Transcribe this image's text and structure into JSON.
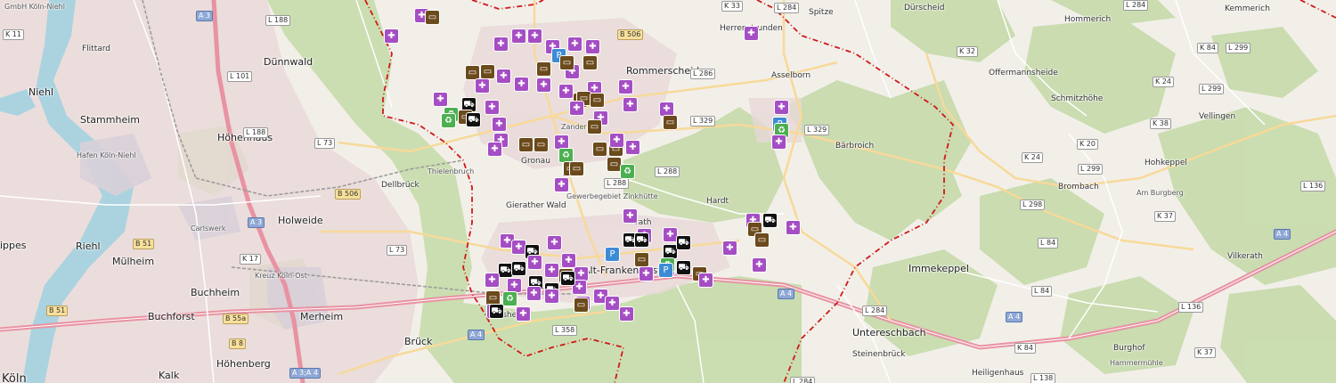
{
  "map": {
    "poi_colors": {
      "medical": "#a54ec4",
      "hotel": "#6b4a1c",
      "car": "#111111",
      "parking": "#3d8bd4",
      "recycling": "#4caf50",
      "generic": "#777777"
    },
    "poi_icons": {
      "medical": "medical-cross-icon",
      "hotel": "hotel-bed-icon",
      "car": "car-icon",
      "parking": "parking-icon",
      "recycling": "recycling-icon",
      "generic": "generic-poi-icon"
    },
    "labels": [
      {
        "id": "gmbh-koln-niehl",
        "text": "GmbH Köln-Niehl"
      },
      {
        "id": "flittard",
        "text": "Flittard"
      },
      {
        "id": "niehl",
        "text": "Niehl"
      },
      {
        "id": "stammheim",
        "text": "Stammheim"
      },
      {
        "id": "hafen-koln-niehl",
        "text": "Hafen Köln-Niehl"
      },
      {
        "id": "dunnwald",
        "text": "Dünnwald"
      },
      {
        "id": "hohenhaus",
        "text": "Höhenhaus"
      },
      {
        "id": "carlswerk",
        "text": "Carlswerk"
      },
      {
        "id": "holweide",
        "text": "Holweide"
      },
      {
        "id": "dellbruck",
        "text": "Dellbrück"
      },
      {
        "id": "riehl",
        "text": "Riehl"
      },
      {
        "id": "ippes",
        "text": "ippes"
      },
      {
        "id": "mulheim",
        "text": "Mülheim"
      },
      {
        "id": "buchheim",
        "text": "Buchheim"
      },
      {
        "id": "buchforst",
        "text": "Buchforst"
      },
      {
        "id": "merheim",
        "text": "Merheim"
      },
      {
        "id": "kalk",
        "text": "Kalk"
      },
      {
        "id": "koln",
        "text": "Köln"
      },
      {
        "id": "hohenberg",
        "text": "Höhenberg"
      },
      {
        "id": "bruck",
        "text": "Brück"
      },
      {
        "id": "gronau",
        "text": "Gronau"
      },
      {
        "id": "zanders",
        "text": "Zanders"
      },
      {
        "id": "gierather-wald",
        "text": "Gierather Wald"
      },
      {
        "id": "gewerbegebiet-zinkhutte",
        "text": "Gewerbegebiet Zinkhütte"
      },
      {
        "id": "alt-frankenforst",
        "text": "Alt-Frankenforst"
      },
      {
        "id": "rommerscheid",
        "text": "Rommerscheid"
      },
      {
        "id": "asselborn",
        "text": "Asselborn"
      },
      {
        "id": "herrenstrunden",
        "text": "Herrenstrunden"
      },
      {
        "id": "spitze",
        "text": "Spitze"
      },
      {
        "id": "durscheid",
        "text": "Dürscheid"
      },
      {
        "id": "offermannsheide",
        "text": "Offermannsheide"
      },
      {
        "id": "barbroich",
        "text": "Bärbroich"
      },
      {
        "id": "hardt",
        "text": "Hardt"
      },
      {
        "id": "immekeppel",
        "text": "Immekeppel"
      },
      {
        "id": "untereschbach",
        "text": "Untereschbach"
      },
      {
        "id": "steinenbruck",
        "text": "Steinenbrück"
      },
      {
        "id": "heiligenhaus",
        "text": "Heiligenhaus"
      },
      {
        "id": "brombach",
        "text": "Brombach"
      },
      {
        "id": "hohkeppel",
        "text": "Hohkeppel"
      },
      {
        "id": "vellingen",
        "text": "Vellingen"
      },
      {
        "id": "vilkerath",
        "text": "Vilkerath"
      },
      {
        "id": "schmitzhohe",
        "text": "Schmitzhöhe"
      },
      {
        "id": "hommerich",
        "text": "Hommerich"
      },
      {
        "id": "kemmerich",
        "text": "Kemmerich"
      },
      {
        "id": "burghof",
        "text": "Burghof"
      },
      {
        "id": "hammermuhle",
        "text": "Hammermühle"
      },
      {
        "id": "kreuz-koln-ost",
        "text": "Kreuz Köln-Ost"
      },
      {
        "id": "bensheide",
        "text": "ensheide"
      },
      {
        "id": "berg",
        "text": "erg"
      },
      {
        "id": "rath",
        "text": "rath"
      },
      {
        "id": "thielenbruch",
        "text": "Thielenbruch"
      },
      {
        "id": "am-burgberg",
        "text": "Am Burgberg"
      }
    ],
    "road_shields": [
      {
        "id": "k11",
        "text": "K 11"
      },
      {
        "id": "a3-top",
        "text": "A 3"
      },
      {
        "id": "l188-top",
        "text": "L 188"
      },
      {
        "id": "l101",
        "text": "L 101"
      },
      {
        "id": "l188-mid",
        "text": "L 188"
      },
      {
        "id": "l73",
        "text": "L 73"
      },
      {
        "id": "b506-mid",
        "text": "B 506"
      },
      {
        "id": "a3-mid",
        "text": "A 3"
      },
      {
        "id": "b51",
        "text": "B 51"
      },
      {
        "id": "k17",
        "text": "K 17"
      },
      {
        "id": "l73-low",
        "text": "L 73"
      },
      {
        "id": "b51-low",
        "text": "B 51"
      },
      {
        "id": "b55a",
        "text": "B 55a"
      },
      {
        "id": "b8",
        "text": "B 8"
      },
      {
        "id": "a3a4",
        "text": "A 3;A 4"
      },
      {
        "id": "a4-left",
        "text": "A 4"
      },
      {
        "id": "l358",
        "text": "L 358"
      },
      {
        "id": "a4-mid",
        "text": "A 4"
      },
      {
        "id": "l284-top",
        "text": "L 284"
      },
      {
        "id": "b506-top",
        "text": "B 506"
      },
      {
        "id": "k33",
        "text": "K 33"
      },
      {
        "id": "l286",
        "text": "L 286"
      },
      {
        "id": "l329",
        "text": "L 329"
      },
      {
        "id": "l329-b",
        "text": "L 329"
      },
      {
        "id": "l288",
        "text": "L 288"
      },
      {
        "id": "k32",
        "text": "K 32"
      },
      {
        "id": "k24",
        "text": "K 24"
      },
      {
        "id": "k38",
        "text": "K 38"
      },
      {
        "id": "l299",
        "text": "L 299"
      },
      {
        "id": "k20",
        "text": "K 20"
      },
      {
        "id": "l284-r",
        "text": "L 284"
      },
      {
        "id": "k84",
        "text": "K 84"
      },
      {
        "id": "l299-b",
        "text": "L 299"
      },
      {
        "id": "k24-b",
        "text": "K 24"
      },
      {
        "id": "l298",
        "text": "L 298"
      },
      {
        "id": "k37",
        "text": "K 37"
      },
      {
        "id": "l136",
        "text": "L 136"
      },
      {
        "id": "l84",
        "text": "L 84"
      },
      {
        "id": "a4-right",
        "text": "A 4"
      },
      {
        "id": "l84-b",
        "text": "L 84"
      },
      {
        "id": "l136-b",
        "text": "L 136"
      },
      {
        "id": "l138",
        "text": "L 138"
      },
      {
        "id": "k37-b",
        "text": "K 37"
      },
      {
        "id": "l284-low",
        "text": "L 284"
      },
      {
        "id": "l284-bottom",
        "text": "L 284"
      },
      {
        "id": "a4-far",
        "text": "A 4"
      },
      {
        "id": "l288-b",
        "text": "L 288"
      },
      {
        "id": "l299-r",
        "text": "L 299"
      },
      {
        "id": "k84-r",
        "text": "K 84"
      }
    ]
  }
}
